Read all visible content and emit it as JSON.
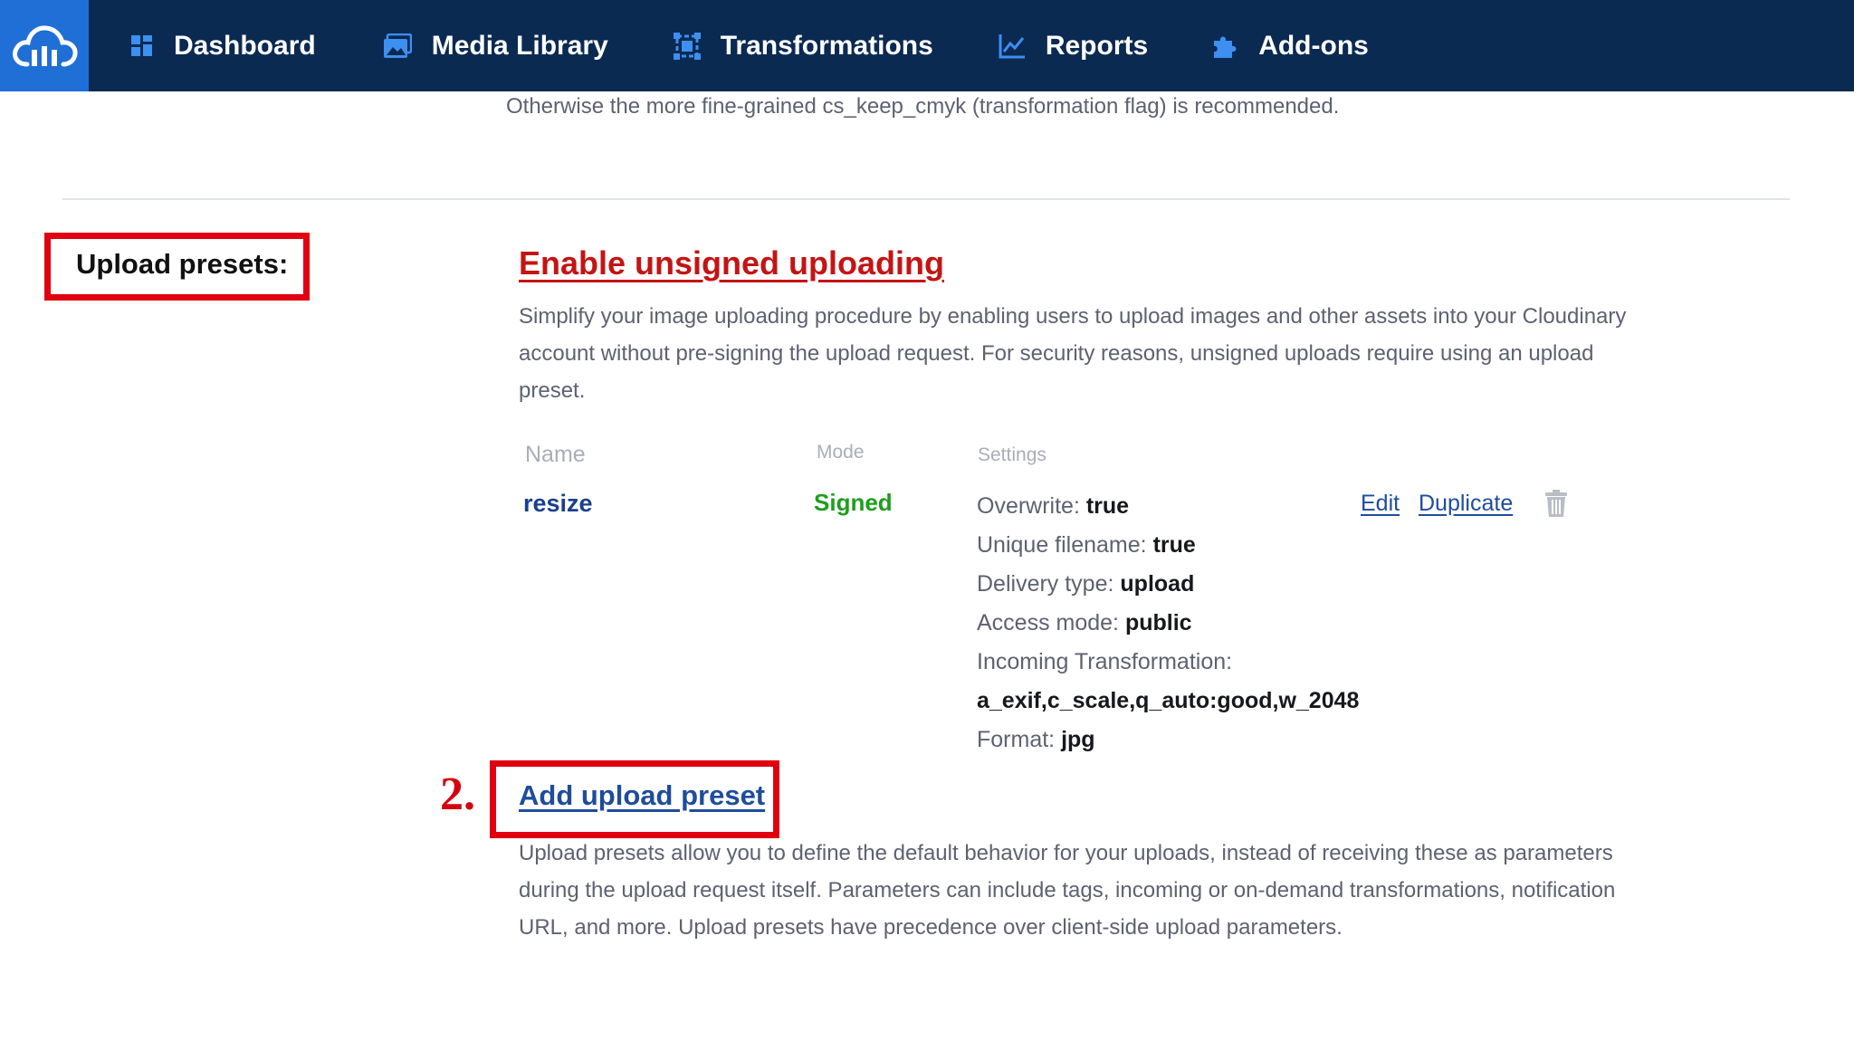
{
  "nav": {
    "logo_icon": "cloud-logo-icon",
    "items": [
      {
        "label": "Dashboard",
        "icon": "grid-icon"
      },
      {
        "label": "Media Library",
        "icon": "image-icon"
      },
      {
        "label": "Transformations",
        "icon": "crop-icon"
      },
      {
        "label": "Reports",
        "icon": "chart-icon"
      },
      {
        "label": "Add-ons",
        "icon": "puzzle-icon"
      }
    ]
  },
  "intro_text": "Otherwise the more fine-grained cs_keep_cmyk (transformation flag) is recommended.",
  "section": {
    "label": "Upload presets:",
    "enable_link": "Enable unsigned uploading",
    "enable_desc": "Simplify your image uploading procedure by enabling users to upload images and other assets into your Cloudinary account without pre-signing the upload request. For security reasons, unsigned uploads require using an upload preset.",
    "columns": {
      "name": "Name",
      "mode": "Mode",
      "settings": "Settings"
    },
    "presets": [
      {
        "name": "resize",
        "mode": "Signed",
        "settings": [
          {
            "key": "Overwrite:",
            "value": "true"
          },
          {
            "key": "Unique filename:",
            "value": "true"
          },
          {
            "key": "Delivery type:",
            "value": "upload"
          },
          {
            "key": "Access mode:",
            "value": "public"
          },
          {
            "key": "Incoming Transformation:",
            "value": ""
          },
          {
            "key": "",
            "value": "a_exif,c_scale,q_auto:good,w_2048"
          },
          {
            "key": "Format:",
            "value": "jpg"
          }
        ],
        "actions": {
          "edit": "Edit",
          "duplicate": "Duplicate",
          "delete_icon": "trash-icon"
        }
      }
    ],
    "annotation_number": "2.",
    "add_link": "Add upload preset",
    "add_desc": "Upload presets allow you to define the default behavior for your uploads, instead of receiving these as parameters during the upload request itself. Parameters can include tags, incoming or on-demand transformations, notification URL, and more. Upload presets have precedence over client-side upload parameters."
  },
  "colors": {
    "topbar": "#0b2a52",
    "logo_bg": "#1f6fd6",
    "annotation_red": "#e0000f",
    "link_blue": "#1f4c9c",
    "enable_red": "#c41414",
    "signed_green": "#1e9e1e"
  }
}
